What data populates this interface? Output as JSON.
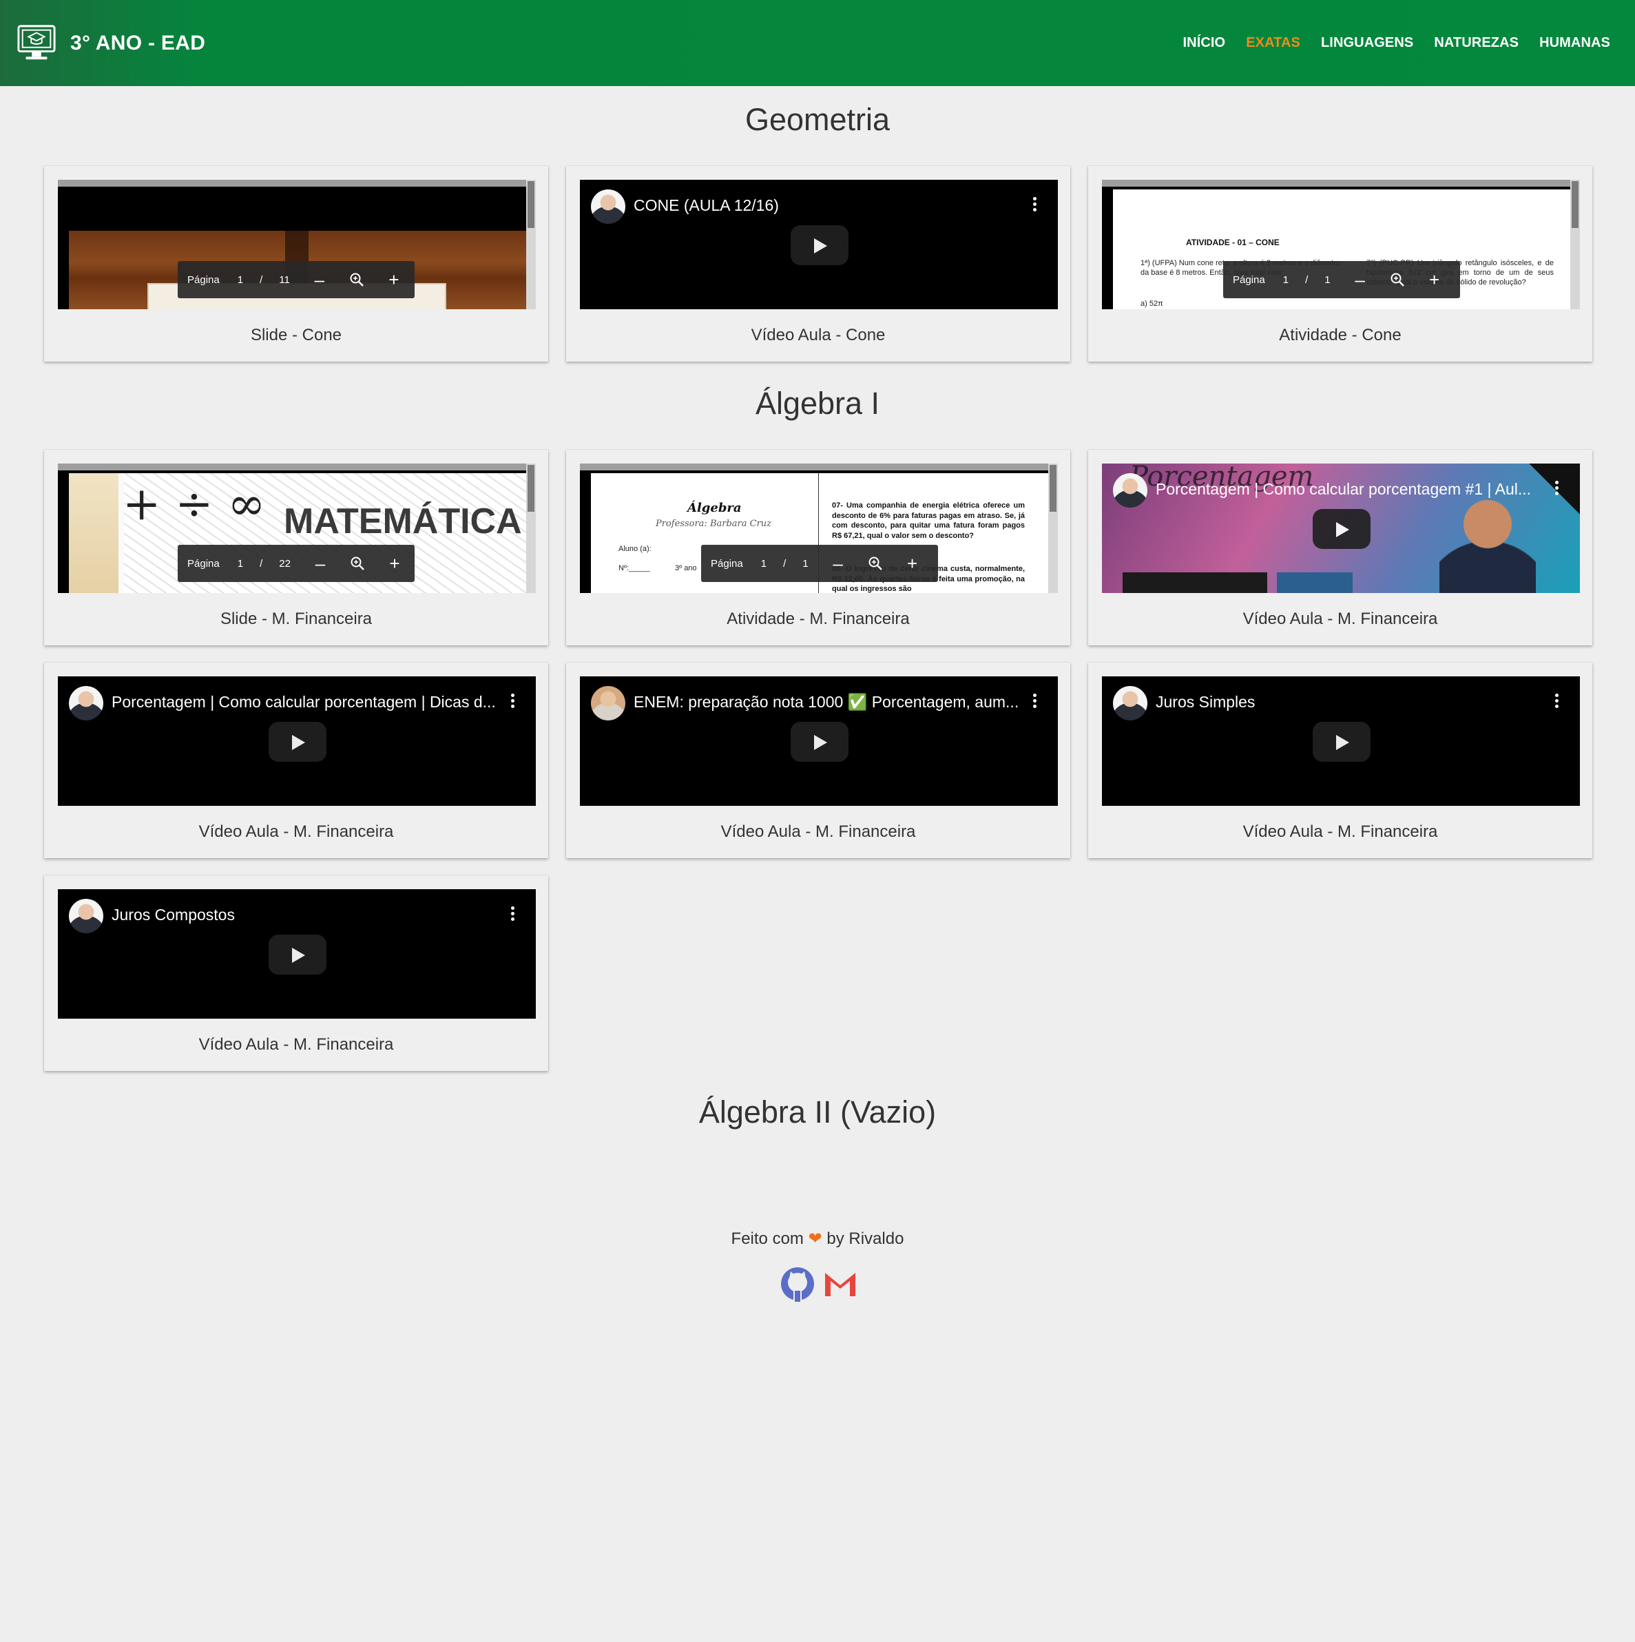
{
  "navbar": {
    "brand_title": "3° ANO - EAD",
    "brand_icon": "computer-education-icon",
    "links": [
      {
        "label": "INÍCIO",
        "active": false
      },
      {
        "label": "EXATAS",
        "active": true
      },
      {
        "label": "LINGUAGENS",
        "active": false
      },
      {
        "label": "NATUREZAS",
        "active": false
      },
      {
        "label": "HUMANAS",
        "active": false
      }
    ],
    "active_color": "#f08a1c",
    "background": "#03883d"
  },
  "sections": [
    {
      "title": "Geometria",
      "cards": [
        {
          "caption": "Slide - Cone",
          "type": "pdf",
          "pdf_label": "Página",
          "page": "1",
          "sep": "/",
          "total": "11"
        },
        {
          "caption": "Vídeo Aula - Cone",
          "type": "video",
          "video_title": "CONE (AULA 12/16)"
        },
        {
          "caption": "Atividade - Cone",
          "type": "pdf",
          "pdf_label": "Página",
          "page": "1",
          "sep": "/",
          "total": "1",
          "doc_heading": "ATIVIDADE - 01 – CONE",
          "doc_q1": "1ª) (UFPA) Num cone reto, a altura é 3 metros e o diâmetro da base é 8 metros. Então, área total vale:",
          "doc_q1_a": "a) 52π",
          "doc_q7": "7ª) (PUC-PR) Um triângulo retângulo isósceles, e de hipotenusa 3√2 cm gira em torno de um de seus catetos. Qual o volume do sólido de revolução?"
        }
      ]
    },
    {
      "title": "Álgebra I",
      "cards": [
        {
          "caption": "Slide - M. Financeira",
          "type": "pdf",
          "pdf_label": "Página",
          "page": "1",
          "sep": "/",
          "total": "22",
          "slide_text": "MATEMÁTICA"
        },
        {
          "caption": "Atividade - M. Financeira",
          "type": "pdf",
          "pdf_label": "Página",
          "page": "1",
          "sep": "/",
          "total": "1",
          "doc_heading": "Álgebra",
          "doc_sub": "Professora: Barbara Cruz",
          "doc_aluno": "Aluno (a):",
          "doc_no": "Nº:_____",
          "doc_ano": "3º ano",
          "doc_q7": "07- Uma companhia de energia elétrica oferece um desconto de 6% para faturas pagas em atraso. Se, já com desconto, para quitar uma fatura foram pagos R$ 67,21, qual o valor sem o desconto?",
          "doc_q8": "08- O ingresso de certo cinema custa, normalmente, R$ 12,00. Às quartas-feiras é feita uma promoção, na qual os ingressos são"
        },
        {
          "caption": "Vídeo Aula - M. Financeira",
          "type": "video",
          "video_title": "Porcentagem | Como calcular porcentagem #1 | Aul...",
          "thumb_text": "Porcentagem"
        },
        {
          "caption": "Vídeo Aula - M. Financeira",
          "type": "video",
          "video_title": "Porcentagem | Como calcular porcentagem | Dicas d..."
        },
        {
          "caption": "Vídeo Aula - M. Financeira",
          "type": "video",
          "video_title": "ENEM: preparação nota 1000 ✅ Porcentagem, aum..."
        },
        {
          "caption": "Vídeo Aula - M. Financeira",
          "type": "video",
          "video_title": "Juros Simples"
        },
        {
          "caption": "Vídeo Aula - M. Financeira",
          "type": "video",
          "video_title": "Juros Compostos"
        }
      ]
    },
    {
      "title": "Álgebra II (Vazio)",
      "cards": []
    }
  ],
  "footer": {
    "text_before": "Feito com",
    "heart": "❤",
    "text_after": "by Rivaldo",
    "icons": [
      "github-icon",
      "gmail-icon"
    ]
  }
}
